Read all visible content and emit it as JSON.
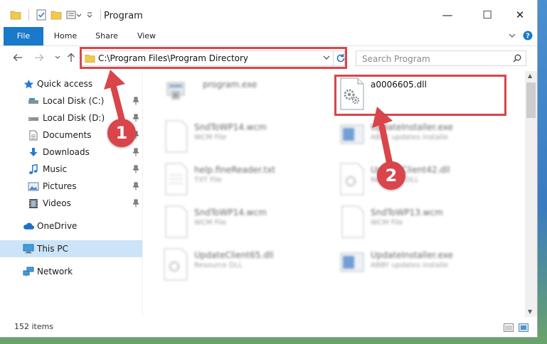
{
  "window": {
    "title": "Program"
  },
  "controls": {
    "minimize": "—",
    "maximize": "☐",
    "close": "✕"
  },
  "ribbon": {
    "tabs": [
      "File",
      "Home",
      "Share",
      "View"
    ]
  },
  "nav": {
    "address": "C:\\Program Files\\Program Directory",
    "search_placeholder": "Search Program"
  },
  "sidebar": {
    "items": [
      {
        "label": "Quick access",
        "icon": "star-icon",
        "pinned": false
      },
      {
        "label": "Local Disk (C:)",
        "icon": "drive-icon",
        "pinned": true
      },
      {
        "label": "Local Disk (D:)",
        "icon": "drive-icon",
        "pinned": true
      },
      {
        "label": "Documents",
        "icon": "documents-icon",
        "pinned": true
      },
      {
        "label": "Downloads",
        "icon": "download-icon",
        "pinned": true
      },
      {
        "label": "Music",
        "icon": "music-icon",
        "pinned": true
      },
      {
        "label": "Pictures",
        "icon": "pictures-icon",
        "pinned": true
      },
      {
        "label": "Videos",
        "icon": "videos-icon",
        "pinned": true
      },
      {
        "label": "OneDrive",
        "icon": "cloud-icon",
        "pinned": false
      },
      {
        "label": "This PC",
        "icon": "computer-icon",
        "pinned": false,
        "selected": true
      },
      {
        "label": "Network",
        "icon": "network-icon",
        "pinned": false
      }
    ]
  },
  "files": [
    {
      "name": "program.exe",
      "type": "",
      "kind": "exe"
    },
    {
      "name": "a0006605.dll",
      "type": "",
      "kind": "dll"
    },
    {
      "name": "SndToWP14.wcm",
      "type": "WCM File",
      "kind": "doc"
    },
    {
      "name": "UpdateInstaller.exe",
      "type": "ABBY updates installe",
      "kind": "installer"
    },
    {
      "name": "help.fineReader.txt",
      "type": "TXT File",
      "kind": "doc"
    },
    {
      "name": "UpdateClient42.dll",
      "type": "Resource DLL",
      "kind": "dll"
    },
    {
      "name": "SndToWP14.wcm",
      "type": "WCM File",
      "kind": "doc"
    },
    {
      "name": "SndToWP13.wcm",
      "type": "WCM File",
      "kind": "doc"
    },
    {
      "name": "UpdateClient65.dll",
      "type": "Resource DLL",
      "kind": "dll"
    },
    {
      "name": "UpdateInstaller.exe",
      "type": "ABBY updates installe",
      "kind": "installer"
    }
  ],
  "status": {
    "items_count": "152 items"
  },
  "annotations": {
    "step1": "1",
    "step2": "2",
    "color": "#d9454a"
  },
  "colors": {
    "accent": "#1979ca",
    "selection": "#cce4f7"
  }
}
